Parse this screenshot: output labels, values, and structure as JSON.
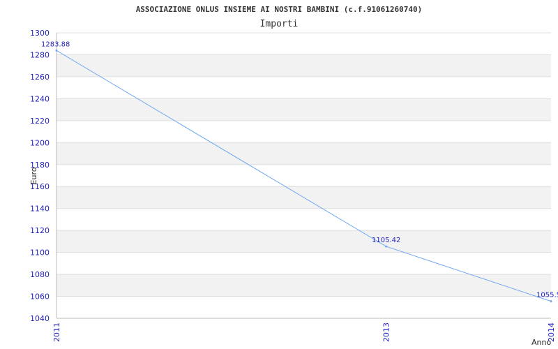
{
  "chart_data": {
    "type": "line",
    "title": "ASSOCIAZIONE ONLUS INSIEME AI NOSTRI BAMBINI (c.f.91061260740)",
    "subtitle": "Importi",
    "xlabel": "Anno",
    "ylabel": "Euro",
    "x": [
      "2011",
      "2013",
      "2014"
    ],
    "series": [
      {
        "name": "",
        "values": [
          1283.88,
          1105.42,
          1055.5
        ]
      }
    ],
    "data_labels": [
      "1283.88",
      "1105.42",
      "1055.5"
    ],
    "ylim": [
      1040,
      1300
    ],
    "yticks": [
      1040,
      1060,
      1080,
      1100,
      1120,
      1140,
      1160,
      1180,
      1200,
      1220,
      1240,
      1260,
      1280,
      1300
    ],
    "grid": true,
    "band_color": "#f2f2f2",
    "line_color": "#6fa8f0",
    "label_color": "#1f1fbf"
  }
}
